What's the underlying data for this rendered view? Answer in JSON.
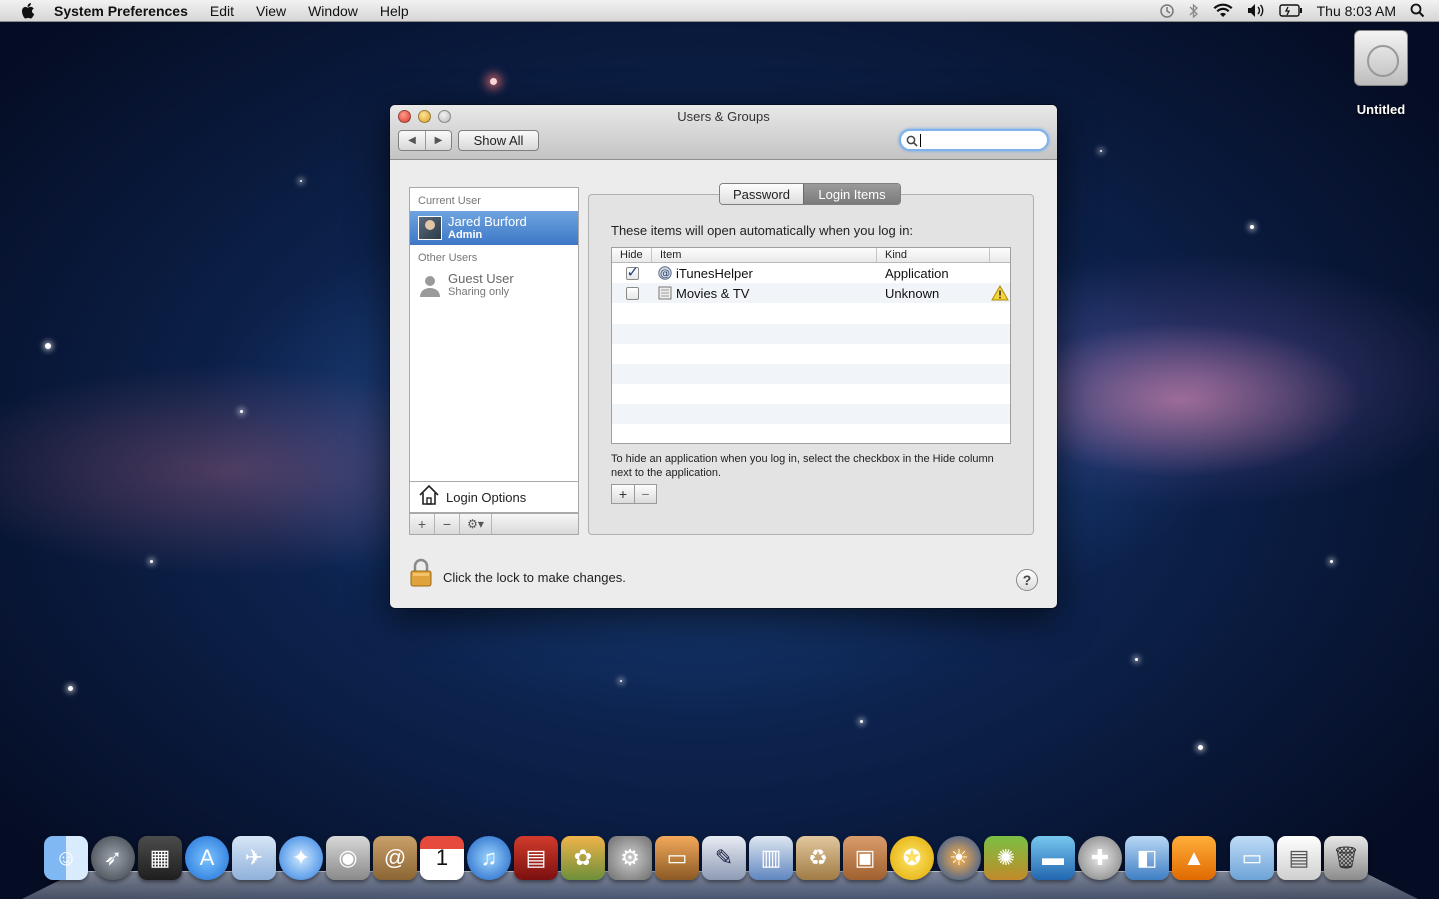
{
  "menubar": {
    "app_name": "System Preferences",
    "menus": [
      "Edit",
      "View",
      "Window",
      "Help"
    ],
    "clock": "Thu 8:03 AM"
  },
  "desktop": {
    "drive_label": "Untitled"
  },
  "window": {
    "title": "Users & Groups",
    "show_all_label": "Show All",
    "search_placeholder": ""
  },
  "users": {
    "current_user_header": "Current User",
    "current_user": {
      "name": "Jared Burford",
      "role": "Admin"
    },
    "other_users_header": "Other Users",
    "other_users": [
      {
        "name": "Guest User",
        "role": "Sharing only"
      }
    ],
    "login_options_label": "Login Options"
  },
  "tabs": [
    {
      "label": "Password",
      "selected": false
    },
    {
      "label": "Login Items",
      "selected": true
    }
  ],
  "login_items": {
    "heading": "These items will open automatically when you log in:",
    "columns": [
      "Hide",
      "Item",
      "Kind"
    ],
    "rows": [
      {
        "hide": true,
        "item": "iTunesHelper",
        "kind": "Application",
        "warning": false
      },
      {
        "hide": false,
        "item": "Movies & TV",
        "kind": "Unknown",
        "warning": true
      }
    ],
    "hint": "To hide an application when you log in, select the checkbox in the Hide column next to the application."
  },
  "lock": {
    "text": "Click the lock to make changes."
  },
  "colors": {
    "selection": "#3d77c7",
    "search_focus": "#7fb2ea"
  },
  "dock": {
    "apps": [
      "finder-icon",
      "launchpad-icon",
      "photo-booth-icon",
      "app-store-icon",
      "preview-icon",
      "safari-icon",
      "facetime-icon",
      "address-book-icon",
      "ical-icon",
      "itunes-icon",
      "photo-slideshow-icon",
      "iphoto-icon",
      "system-preferences-icon",
      "keynote-icon",
      "textedit-icon",
      "numbers-icon",
      "archive-utility-icon",
      "compress-icon",
      "cyberduck-icon",
      "firefox-icon",
      "cocktail-icon",
      "remote-desktop-icon",
      "disk-utility-icon",
      "flashcard-icon",
      "vlc-icon"
    ],
    "stacks": [
      "documents-folder-icon",
      "downloads-stack-icon",
      "trash-icon"
    ]
  }
}
